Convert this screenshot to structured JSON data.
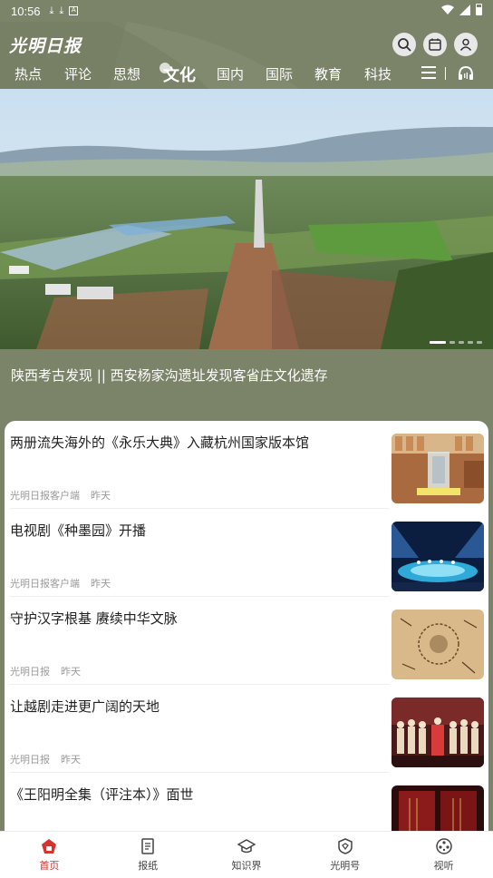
{
  "status_bar": {
    "time": "10:56",
    "box_glyph": "A"
  },
  "header": {
    "logo": "光明日报",
    "nav": [
      {
        "label": "热点"
      },
      {
        "label": "评论"
      },
      {
        "label": "思想"
      },
      {
        "label": "文化",
        "active": true
      },
      {
        "label": "国内"
      },
      {
        "label": "国际"
      },
      {
        "label": "教育"
      },
      {
        "label": "科技"
      }
    ]
  },
  "hero": {
    "caption": "陕西考古发现 || 西安杨家沟遗址发现客省庄文化遗存",
    "slide_count": 5,
    "active_slide": 1
  },
  "articles": [
    {
      "title": "两册流失海外的《永乐大典》入藏杭州国家版本馆",
      "source": "光明日报客户端",
      "time": "昨天",
      "thumb": "museum-exhibit"
    },
    {
      "title": "电视剧《种墨园》开播",
      "source": "光明日报客户端",
      "time": "昨天",
      "thumb": "stage-event"
    },
    {
      "title": "守护汉字根基 赓续中华文脉",
      "source": "光明日报",
      "time": "昨天",
      "thumb": "calligraphy-art"
    },
    {
      "title": "让越剧走进更广阔的天地",
      "source": "光明日报",
      "time": "昨天",
      "thumb": "opera-stage"
    },
    {
      "title": "《王阳明全集（评注本）》面世",
      "source": "",
      "time": "",
      "thumb": "book-cover"
    }
  ],
  "tabbar": [
    {
      "label": "首页",
      "icon": "home-icon",
      "active": true
    },
    {
      "label": "报纸",
      "icon": "newspaper-icon"
    },
    {
      "label": "知识界",
      "icon": "graduation-cap-icon"
    },
    {
      "label": "光明号",
      "icon": "shield-icon"
    },
    {
      "label": "视听",
      "icon": "film-reel-icon"
    }
  ],
  "colors": {
    "header_bg": "#7b8369",
    "accent": "#d23431"
  }
}
